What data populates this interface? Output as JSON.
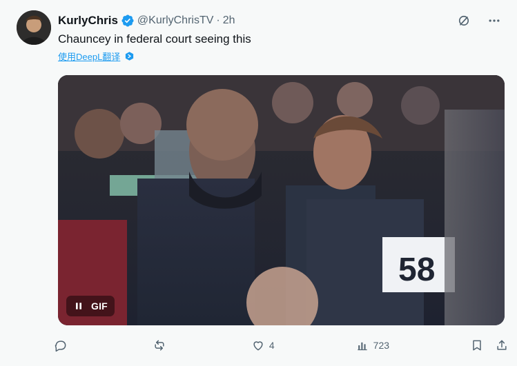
{
  "tweet": {
    "display_name": "KurlyChris",
    "handle": "@KurlyChrisTV",
    "separator": "·",
    "time": "2h",
    "text": "Chauncey in federal court seeing this",
    "translate_label": "使用DeepL翻译",
    "verified": true,
    "avatar_icon": "user-avatar",
    "top_icons": [
      "grok-icon",
      "more-icon"
    ]
  },
  "media": {
    "type": "gif",
    "pause_icon": "pause-icon",
    "gif_label": "GIF",
    "jersey_number": "58"
  },
  "actions": {
    "reply": {
      "icon": "reply-icon",
      "count": ""
    },
    "repost": {
      "icon": "repost-icon",
      "count": ""
    },
    "like": {
      "icon": "heart-icon",
      "count": "4"
    },
    "views": {
      "icon": "views-icon",
      "count": "723"
    },
    "bookmark": {
      "icon": "bookmark-icon"
    },
    "share": {
      "icon": "share-icon"
    }
  },
  "colors": {
    "background": "#f7f9f9",
    "text": "#0f1419",
    "secondary": "#536471",
    "verified": "#1d9bf0"
  }
}
